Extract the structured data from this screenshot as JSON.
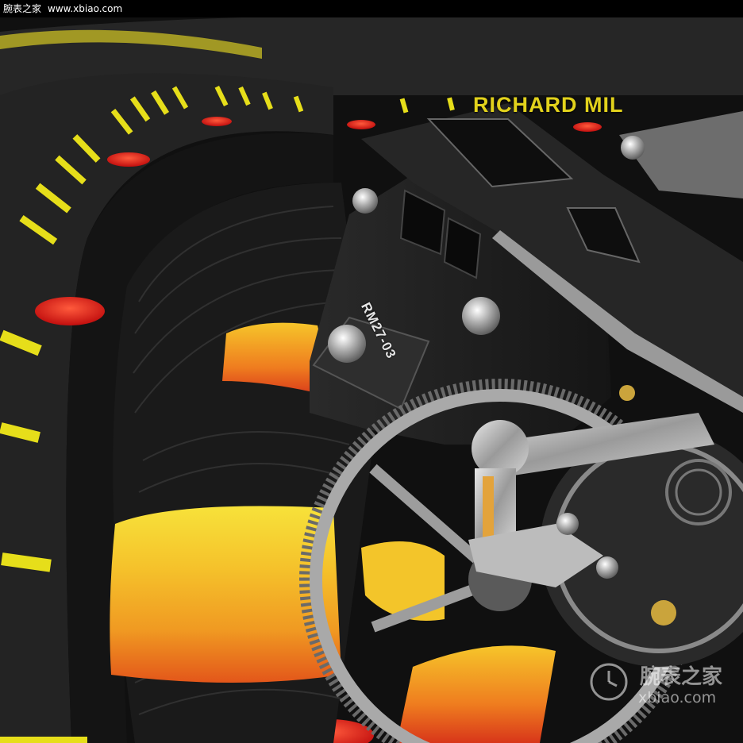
{
  "header": {
    "site_name": "腕表之家",
    "site_url": "www.xbiao.com"
  },
  "watch": {
    "reference_engraving": "RM27-03",
    "brand_text": "RICHARD MIL"
  },
  "watermark": {
    "cn": "腕表之家",
    "url": "xbiao.com"
  },
  "colors": {
    "accent_yellow": "#e6de1a",
    "marker_red": "#e8201a",
    "case_black": "#1c1c1c",
    "steel": "#b8b8b8",
    "glow_orange": "#f3a21e"
  }
}
